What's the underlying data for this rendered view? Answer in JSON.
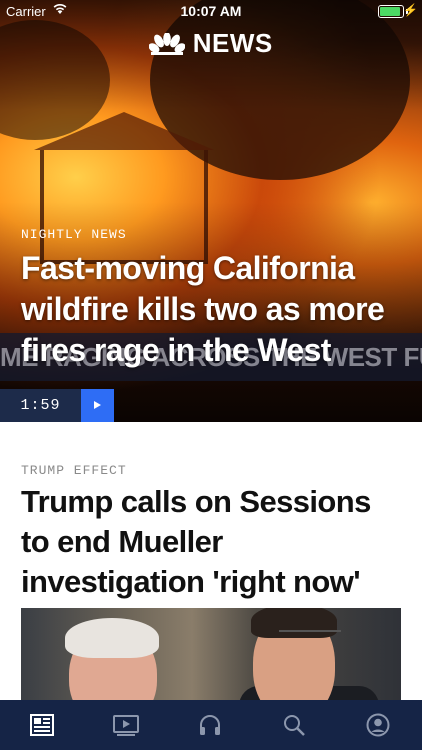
{
  "status_bar": {
    "carrier": "Carrier",
    "time": "10:07 AM",
    "battery_color": "#4cd964"
  },
  "brand": {
    "name": "NEWS",
    "logo_icon": "nbc-peacock-icon"
  },
  "hero": {
    "kicker": "NIGHTLY NEWS",
    "headline": "Fast-moving California wildfire kills two as more fires rage in the West",
    "ticker_text": "ME RAGING ACROSS THE WEST FUELED BY INFER",
    "duration": "1:59",
    "play_icon": "play-icon",
    "duration_bg": "#1d2b4a",
    "play_bg": "#2e6df5"
  },
  "story": {
    "kicker": "TRUMP EFFECT",
    "headline": "Trump calls on Sessions to end Mueller investigation 'right now'"
  },
  "tab_bar": {
    "background": "#152446",
    "tabs": [
      {
        "icon": "news-feed-icon",
        "active": true
      },
      {
        "icon": "video-icon",
        "active": false
      },
      {
        "icon": "headphones-icon",
        "active": false
      },
      {
        "icon": "search-icon",
        "active": false
      },
      {
        "icon": "profile-icon",
        "active": false
      }
    ]
  }
}
